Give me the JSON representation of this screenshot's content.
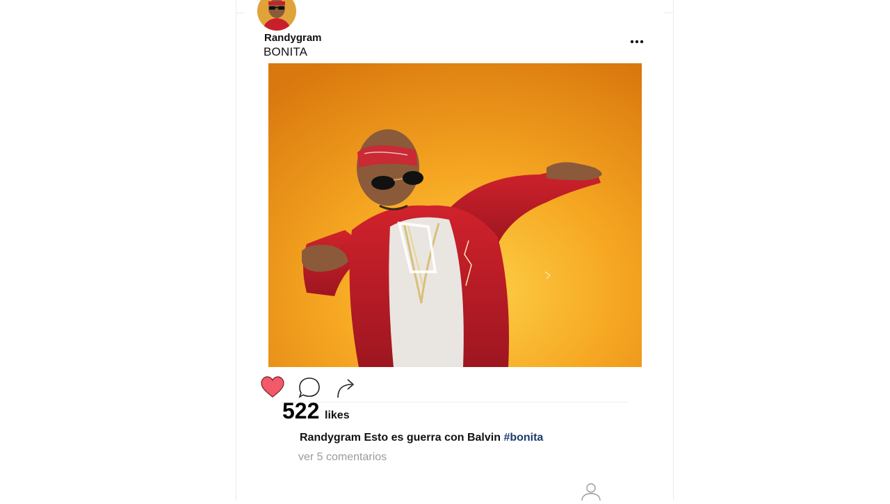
{
  "post": {
    "username": "Randygram",
    "title": "BONITA",
    "likes_count": "522",
    "likes_label": "likes",
    "caption_user": "Randygram",
    "caption_text": " Esto es guerra con Balvin ",
    "caption_hashtag": "#bonita",
    "comments_link": "ver 5 comentarios",
    "liked": true
  },
  "icons": {
    "more": "more-options-icon",
    "like": "heart-icon",
    "comment": "comment-icon",
    "share": "share-icon",
    "profile": "profile-icon"
  },
  "colors": {
    "heart_fill": "#f25a6a",
    "hashtag": "#1d3b6e",
    "muted_text": "#9a9a9a",
    "photo_bg": "#f0a020"
  }
}
